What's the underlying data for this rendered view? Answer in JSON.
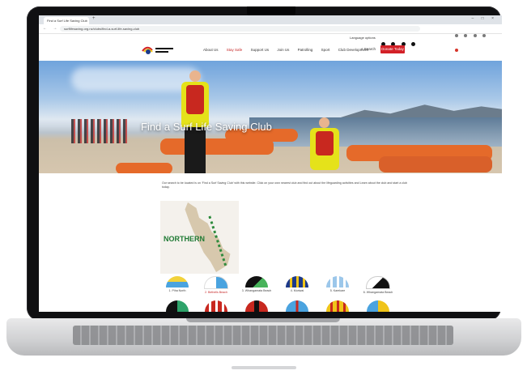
{
  "browser": {
    "tab_title": "Find a Surf Life Saving Club",
    "new_tab_symbol": "+",
    "window_controls": "– □ ×",
    "nav_symbols": "← → ⟳",
    "url": "surflifesaving.org.nz/clubs/find-a-surf-life-saving-club"
  },
  "site": {
    "utility_text": "Language options",
    "social_icons": [
      "facebook-icon",
      "youtube-icon",
      "instagram-icon",
      "twitter-icon"
    ],
    "logo_alt": "Surf Life Saving New Zealand",
    "nav_items": [
      {
        "label": "About Us",
        "active": false
      },
      {
        "label": "Stay Safe",
        "active": true
      },
      {
        "label": "Support Us",
        "active": false
      },
      {
        "label": "Join Us",
        "active": false
      },
      {
        "label": "Patrolling",
        "active": false
      },
      {
        "label": "Sport",
        "active": false
      },
      {
        "label": "Club Development",
        "active": false
      }
    ],
    "search_label": "Search",
    "donate_label": "Donate Today",
    "accent": "#d32027"
  },
  "hero": {
    "title": "Find a Surf Life Saving Club"
  },
  "intro": {
    "text": "Our search to be located is on ‘Find a Surf Saving Club’ with this website. Click on your own nearest club and find out about the lifeguarding activities and Learn about the club and start a club today."
  },
  "map": {
    "region_label": "NORTHERN"
  },
  "clubs_row1": [
    {
      "name": "1. Piha North",
      "red": false,
      "colors": [
        "#f2d23a",
        "#4aa3df"
      ]
    },
    {
      "name": "2. Bethells Beach",
      "red": true,
      "colors": [
        "#ffffff",
        "#4aa3df"
      ]
    },
    {
      "name": "3. Whangamata Beach",
      "red": false,
      "colors": [
        "#111111",
        "#48b35b"
      ]
    },
    {
      "name": "4. Muriwai",
      "red": false,
      "colors": [
        "#1d3a8a",
        "#f0c419"
      ]
    },
    {
      "name": "5. Karekare",
      "red": false,
      "colors": [
        "#9cc7ea",
        "#ffffff"
      ]
    },
    {
      "name": "6. Whangamata Beach",
      "red": false,
      "colors": [
        "#111111",
        "#ffffff"
      ]
    }
  ],
  "clubs_row2": [
    {
      "colors": [
        "#111111",
        "#2ea36a"
      ]
    },
    {
      "colors": [
        "#c8281f",
        "#ffffff"
      ]
    },
    {
      "colors": [
        "#c8281f",
        "#111111"
      ]
    },
    {
      "colors": [
        "#4aa3df",
        "#c8281f"
      ]
    },
    {
      "colors": [
        "#f0c419",
        "#c8281f"
      ]
    },
    {
      "colors": [
        "#4aa3df",
        "#f0c419"
      ]
    }
  ]
}
